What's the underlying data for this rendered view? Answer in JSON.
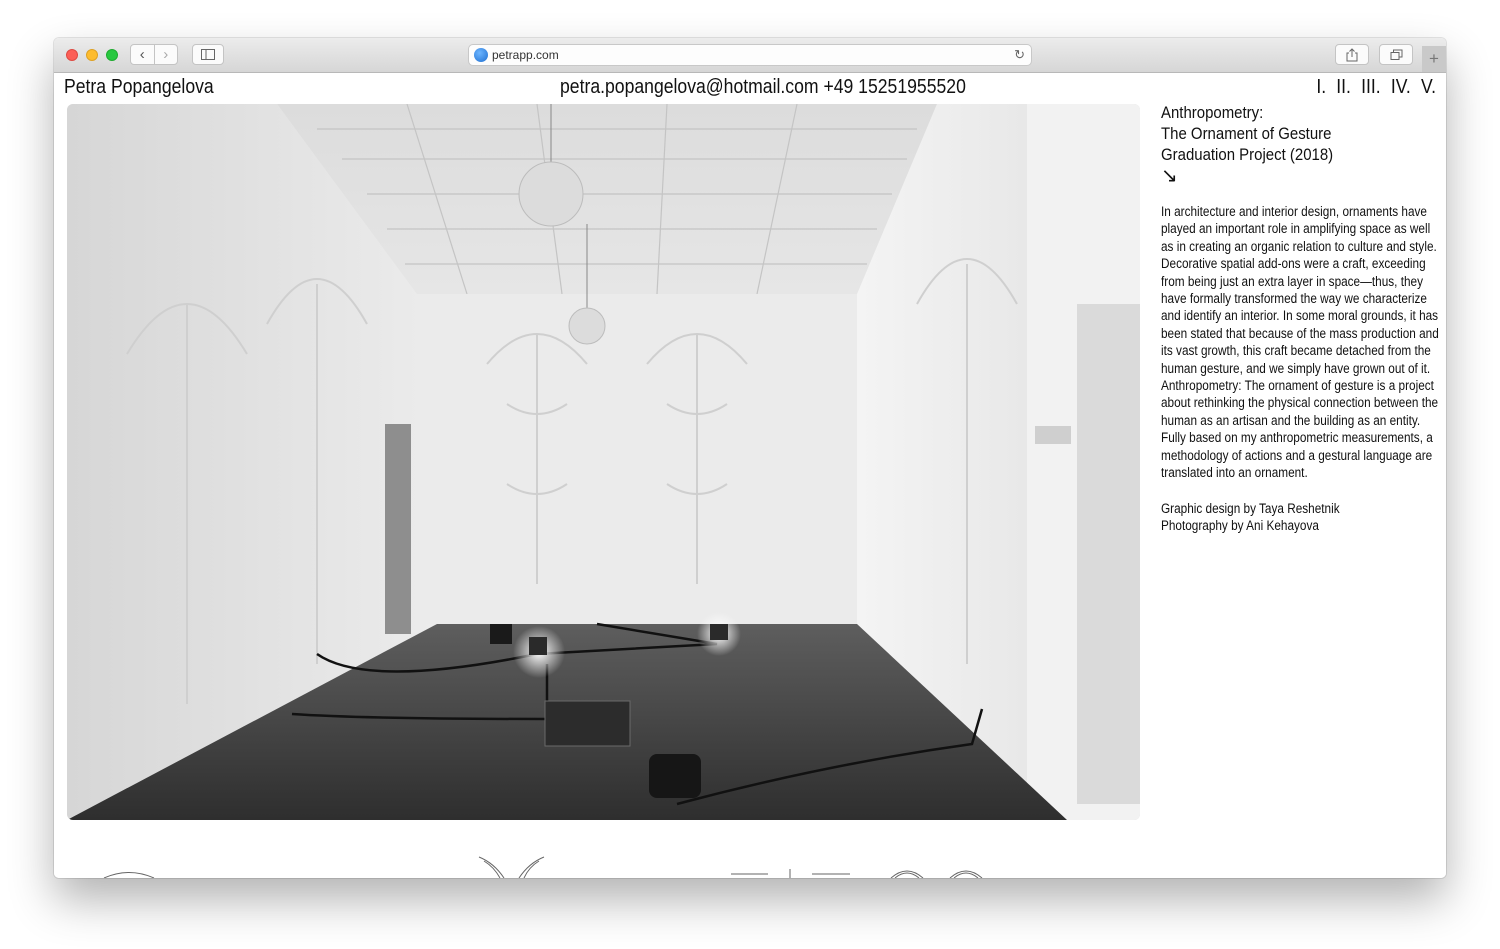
{
  "browser": {
    "url": "petrapp.com",
    "icons": [
      "back-icon",
      "forward-icon",
      "sidebar-icon",
      "globe-icon",
      "reload-icon",
      "share-icon",
      "tabs-icon",
      "plus-icon"
    ]
  },
  "header": {
    "site_name": "Petra Popangelova",
    "contact": "petra.popangelova@hotmail.com +49 15251955520",
    "nav": [
      "I.",
      "II.",
      "III.",
      "IV.",
      "V."
    ]
  },
  "project": {
    "title_line1": "Anthropometry:",
    "title_line2": "The Ornament of Gesture",
    "title_line3": "Graduation Project (2018)",
    "arrow": "↘",
    "description": "In architecture and interior design, ornaments have played an important role in amplifying space as well as in creating an organic relation to culture and style. Decorative spatial add-ons were a craft, exceeding from being just an extra layer in space—thus, they have formally transformed the way we characterize and identify an interior. In some moral grounds, it has been stated that because of the mass production and its vast growth, this craft became detached from the human gesture, and we simply have grown out of it. Anthropometry: The ornament of gesture is a project about rethinking the physical connection between the human as an artisan and the building as an entity. Fully based on my anthropometric measurements, a methodology of actions and a gestural language are translated into an ornament.",
    "credit_design": "Graphic design by Taya Reshetnik",
    "credit_photo": "Photography by Ani Kehayova"
  }
}
